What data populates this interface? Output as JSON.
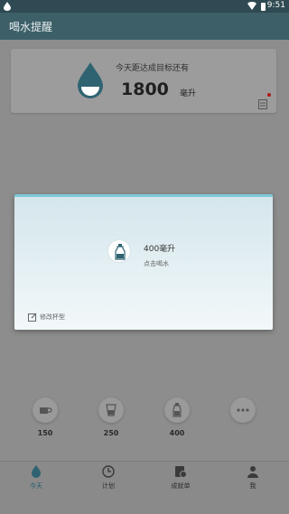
{
  "status_bar": {
    "time": "9:51"
  },
  "app_bar": {
    "title": "喝水提醒"
  },
  "goal_card": {
    "label": "今天距达成目标还有",
    "value": "1800",
    "unit": "毫升"
  },
  "cups": [
    {
      "label": "150",
      "icon": "cup-icon"
    },
    {
      "label": "250",
      "icon": "glass-icon"
    },
    {
      "label": "400",
      "icon": "bottle-icon"
    },
    {
      "label": "",
      "icon": "more-icon"
    }
  ],
  "dialog": {
    "cup_title": "400毫升",
    "tap_hint": "点击喝水",
    "edit_label": "修改杯型"
  },
  "nav": [
    {
      "label": "今天",
      "icon": "drop-icon",
      "active": true
    },
    {
      "label": "计划",
      "icon": "clock-icon"
    },
    {
      "label": "成就单",
      "icon": "badge-icon"
    },
    {
      "label": "我",
      "icon": "person-icon"
    }
  ],
  "colors": {
    "app_bar": "#3d6068",
    "status_bar": "#2f4a52",
    "accent": "#1f5c6e",
    "dialog_top": "#7bc9d8",
    "badge_red": "#b01818"
  }
}
